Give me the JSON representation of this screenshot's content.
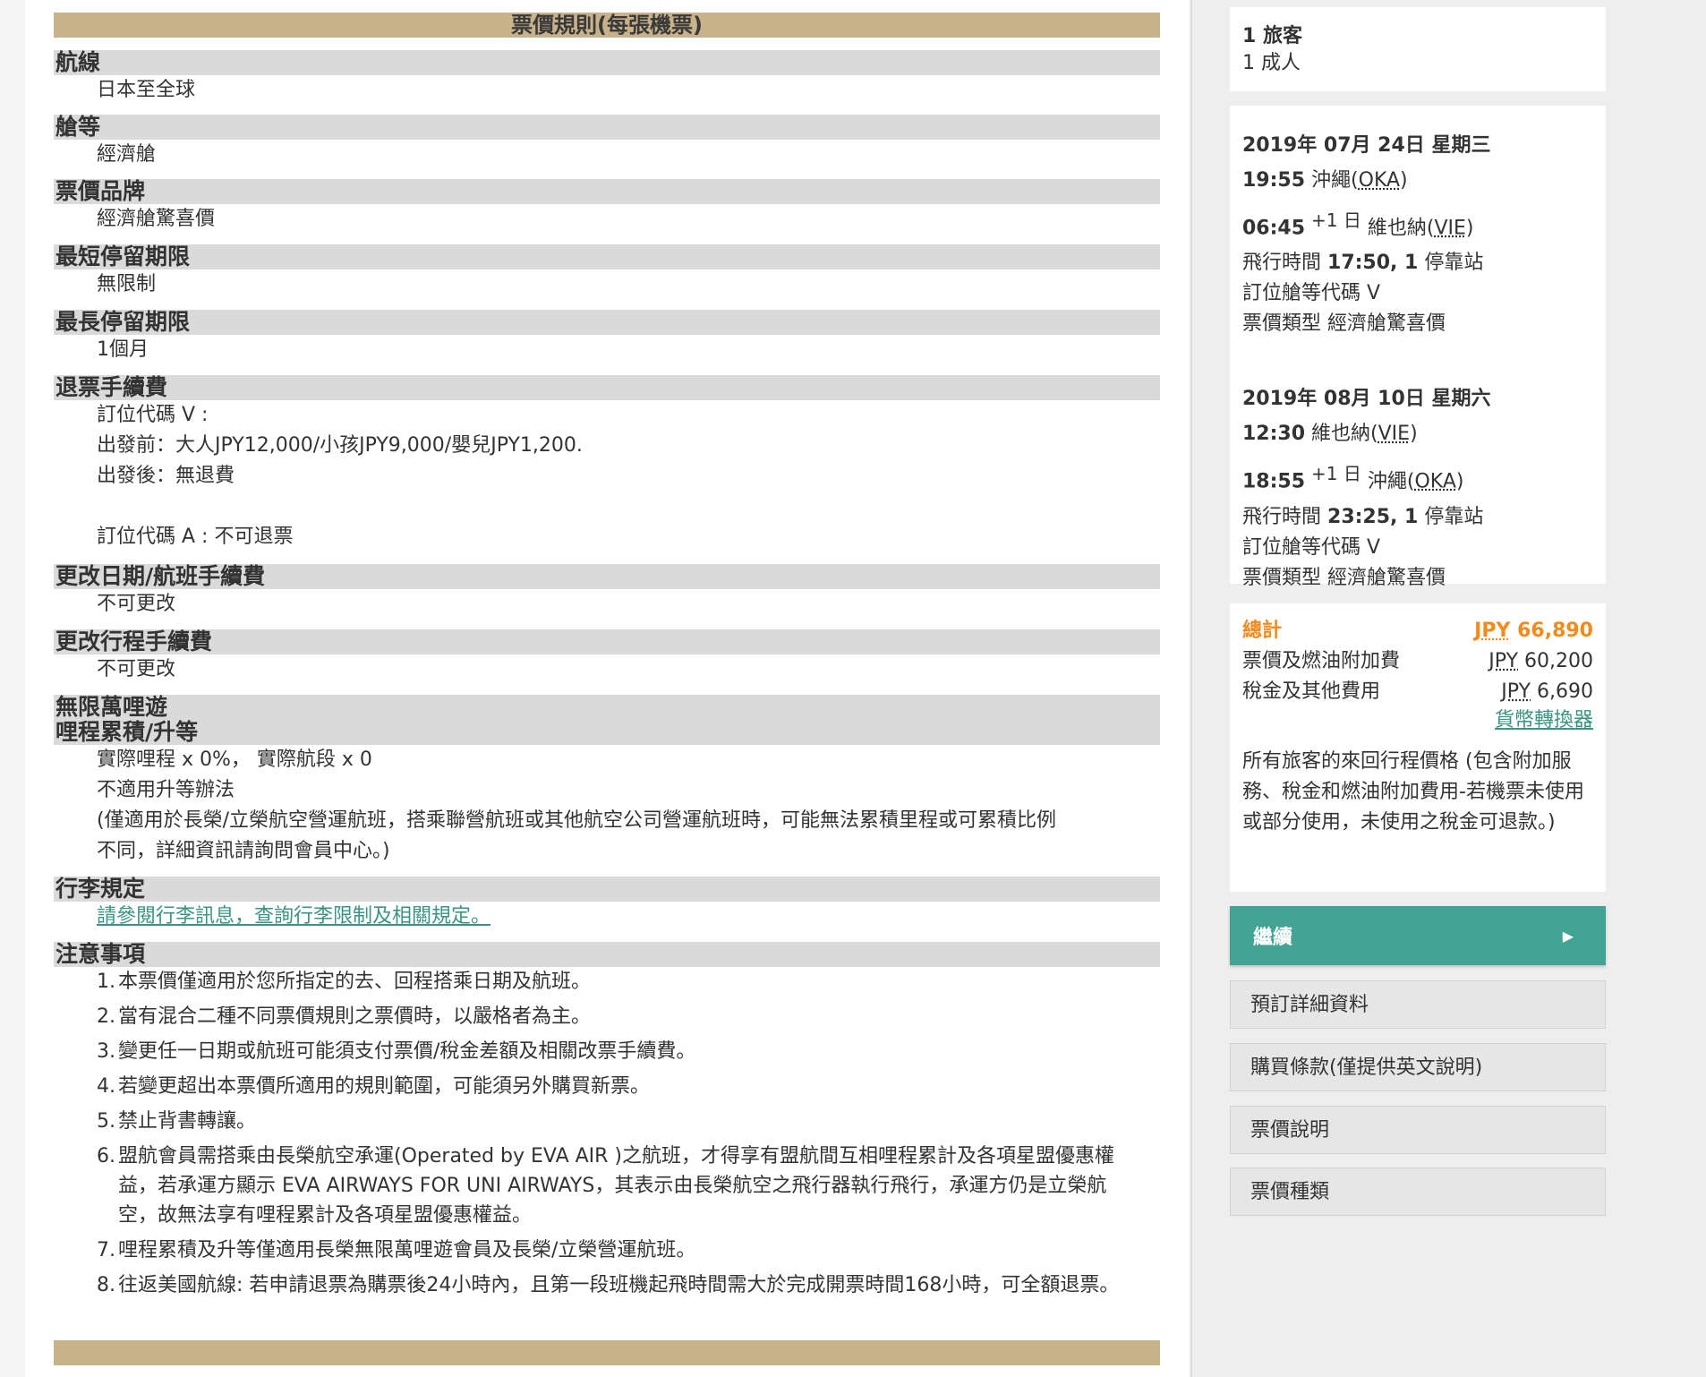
{
  "rules": {
    "header": "票價規則(每張機票)",
    "route": {
      "title": "航線",
      "value": "日本至全球"
    },
    "cabin": {
      "title": "艙等",
      "value": "經濟艙"
    },
    "brand": {
      "title": "票價品牌",
      "value": "經濟艙驚喜價"
    },
    "min_stay": {
      "title": "最短停留期限",
      "value": "無限制"
    },
    "max_stay": {
      "title": "最長停留期限",
      "value": "1個月"
    },
    "refund": {
      "title": "退票手續費",
      "line1": "訂位代碼 V :",
      "line2": "出發前：大人JPY12,000/小孩JPY9,000/嬰兒JPY1,200.",
      "line3": "出發後：無退費",
      "line4": "訂位代碼 A : 不可退票"
    },
    "change_date": {
      "title": "更改日期/航班手續費",
      "value": "不可更改"
    },
    "change_itinerary": {
      "title": "更改行程手續費",
      "value": "不可更改"
    },
    "mileage": {
      "title1": "無限萬哩遊",
      "title2": "哩程累積/升等",
      "line1": "實際哩程 x 0%， 實際航段 x 0",
      "line2": "不適用升等辦法",
      "line3": "(僅適用於長榮/立榮航空營運航班，搭乘聯營航班或其他航空公司營運航班時，可能無法累積里程或可累積比例",
      "line4": "不同，詳細資訊請詢問會員中心。)"
    },
    "baggage": {
      "title": "行李規定",
      "link": "請參閱行李訊息，查詢行李限制及相關規定。"
    },
    "notes": {
      "title": "注意事項",
      "items": [
        {
          "num": "1.",
          "text": "本票價僅適用於您所指定的去、回程搭乘日期及航班。"
        },
        {
          "num": "2.",
          "text": "當有混合二種不同票價規則之票價時，以嚴格者為主。"
        },
        {
          "num": "3.",
          "text": "變更任一日期或航班可能須支付票價/稅金差額及相關改票手續費。"
        },
        {
          "num": "4.",
          "text": "若變更超出本票價所適用的規則範圍，可能須另外購買新票。"
        },
        {
          "num": "5.",
          "text": "禁止背書轉讓。"
        },
        {
          "num": "6.",
          "text": "盟航會員需搭乘由長榮航空承運(Operated by EVA AIR )之航班，才得享有盟航間互相哩程累計及各項星盟優惠權益，若承運方顯示 EVA AIRWAYS FOR UNI AIRWAYS，其表示由長榮航空之飛行器執行飛行，承運方仍是立榮航空，故無法享有哩程累計及各項星盟優惠權益。"
        },
        {
          "num": "7.",
          "text": "哩程累積及升等僅適用長榮無限萬哩遊會員及長榮/立榮營運航班。"
        },
        {
          "num": "8.",
          "text": "往返美國航線: 若申請退票為購票後24小時內，且第一段班機起飛時間需大於完成開票時間168小時，可全額退票。"
        }
      ]
    }
  },
  "sidebar": {
    "passengers": {
      "count": "1 旅客",
      "detail": "1 成人"
    },
    "outbound": {
      "date": "2019年 07月 24日 星期三",
      "dep_time": "19:55",
      "dep_city": "沖繩(",
      "dep_code": "OKA",
      "dep_close": ")",
      "arr_time": "06:45",
      "arr_offset": "+1 日",
      "arr_city": "維也納(",
      "arr_code": "VIE",
      "arr_close": ")",
      "duration_label": "飛行時間",
      "duration": "17:50, 1",
      "stops": "停靠站",
      "class_label": "訂位艙等代碼",
      "class_value": "V",
      "fare_label": "票價類型",
      "fare_value": "經濟艙驚喜價"
    },
    "inbound": {
      "date": "2019年 08月 10日 星期六",
      "dep_time": "12:30",
      "dep_city": "維也納(",
      "dep_code": "VIE",
      "dep_close": ")",
      "arr_time": "18:55",
      "arr_offset": "+1 日",
      "arr_city": "沖繩(",
      "arr_code": "OKA",
      "arr_close": ")",
      "duration_label": "飛行時間",
      "duration": "23:25, 1",
      "stops": "停靠站",
      "class_label": "訂位艙等代碼",
      "class_value": "V",
      "fare_label": "票價類型",
      "fare_value": "經濟艙驚喜價"
    },
    "price": {
      "total_label": "總計",
      "total_currency": "JPY",
      "total_amount": "66,890",
      "fare_label": "票價及燃油附加費",
      "fare_currency": "JPY",
      "fare_amount": "60,200",
      "tax_label": "稅金及其他費用",
      "tax_currency": "JPY",
      "tax_amount": "6,690",
      "converter": "貨幣轉換器",
      "note": "所有旅客的來回行程價格 (包含附加服務、稅金和燃油附加費用-若機票未使用或部分使用，未使用之稅金可退款。)"
    },
    "continue_label": "繼續",
    "buttons": {
      "details": "預訂詳細資料",
      "terms": "購買條款(僅提供英文說明)",
      "fare_info": "票價說明",
      "fare_types": "票價種類"
    }
  }
}
